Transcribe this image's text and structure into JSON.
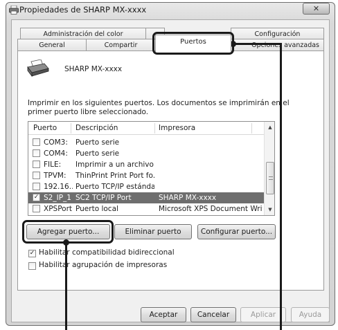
{
  "window": {
    "title": "Propiedades de SHARP MX-xxxx",
    "close_glyph": "✕"
  },
  "tabs": {
    "row1": [
      "Administración del color",
      "Configuración"
    ],
    "row2": [
      "General",
      "Compartir",
      "Puertos",
      "Opciones avanzadas"
    ],
    "active": "Puertos"
  },
  "printer": {
    "name": "SHARP MX-xxxx",
    "icon": "printer-icon"
  },
  "instructions": {
    "line1": "Imprimir en los siguientes puertos. Los documentos se imprimirán en el",
    "line2": "primer puerto libre seleccionado."
  },
  "port_list": {
    "columns": [
      "Puerto",
      "Descripción",
      "Impresora"
    ],
    "rows": [
      {
        "checked": false,
        "port": "COM3:",
        "description": "Puerto serie",
        "printer": "",
        "selected": false
      },
      {
        "checked": false,
        "port": "COM4:",
        "description": "Puerto serie",
        "printer": "",
        "selected": false
      },
      {
        "checked": false,
        "port": "FILE:",
        "description": "Imprimir a un archivo",
        "printer": "",
        "selected": false
      },
      {
        "checked": false,
        "port": "TPVM:",
        "description": "ThinPrint Print Port fo...",
        "printer": "",
        "selected": false
      },
      {
        "checked": false,
        "port": "192.16...",
        "description": "Puerto TCP/IP estándar",
        "printer": "",
        "selected": false
      },
      {
        "checked": true,
        "port": "S2_IP_1",
        "description": "SC2 TCP/IP Port",
        "printer": "SHARP MX-xxxx",
        "selected": true
      },
      {
        "checked": false,
        "port": "XPSPort:",
        "description": "Puerto local",
        "printer": "Microsoft XPS Document Writer",
        "selected": false
      }
    ]
  },
  "port_buttons": {
    "add": "Agregar puerto...",
    "remove": "Eliminar puerto",
    "configure": "Configurar puerto..."
  },
  "options": {
    "bidirectional": {
      "checked": true,
      "label": "Habilitar compatibilidad bidireccional"
    },
    "pooling": {
      "checked": false,
      "label": "Habilitar agrupación de impresoras"
    }
  },
  "dialog_buttons": {
    "ok": "Aceptar",
    "cancel": "Cancelar",
    "apply": "Aplicar",
    "help": "Ayuda"
  },
  "colors": {
    "selected_row": "#6e6e6e",
    "highlight": "#1a1a1a"
  }
}
